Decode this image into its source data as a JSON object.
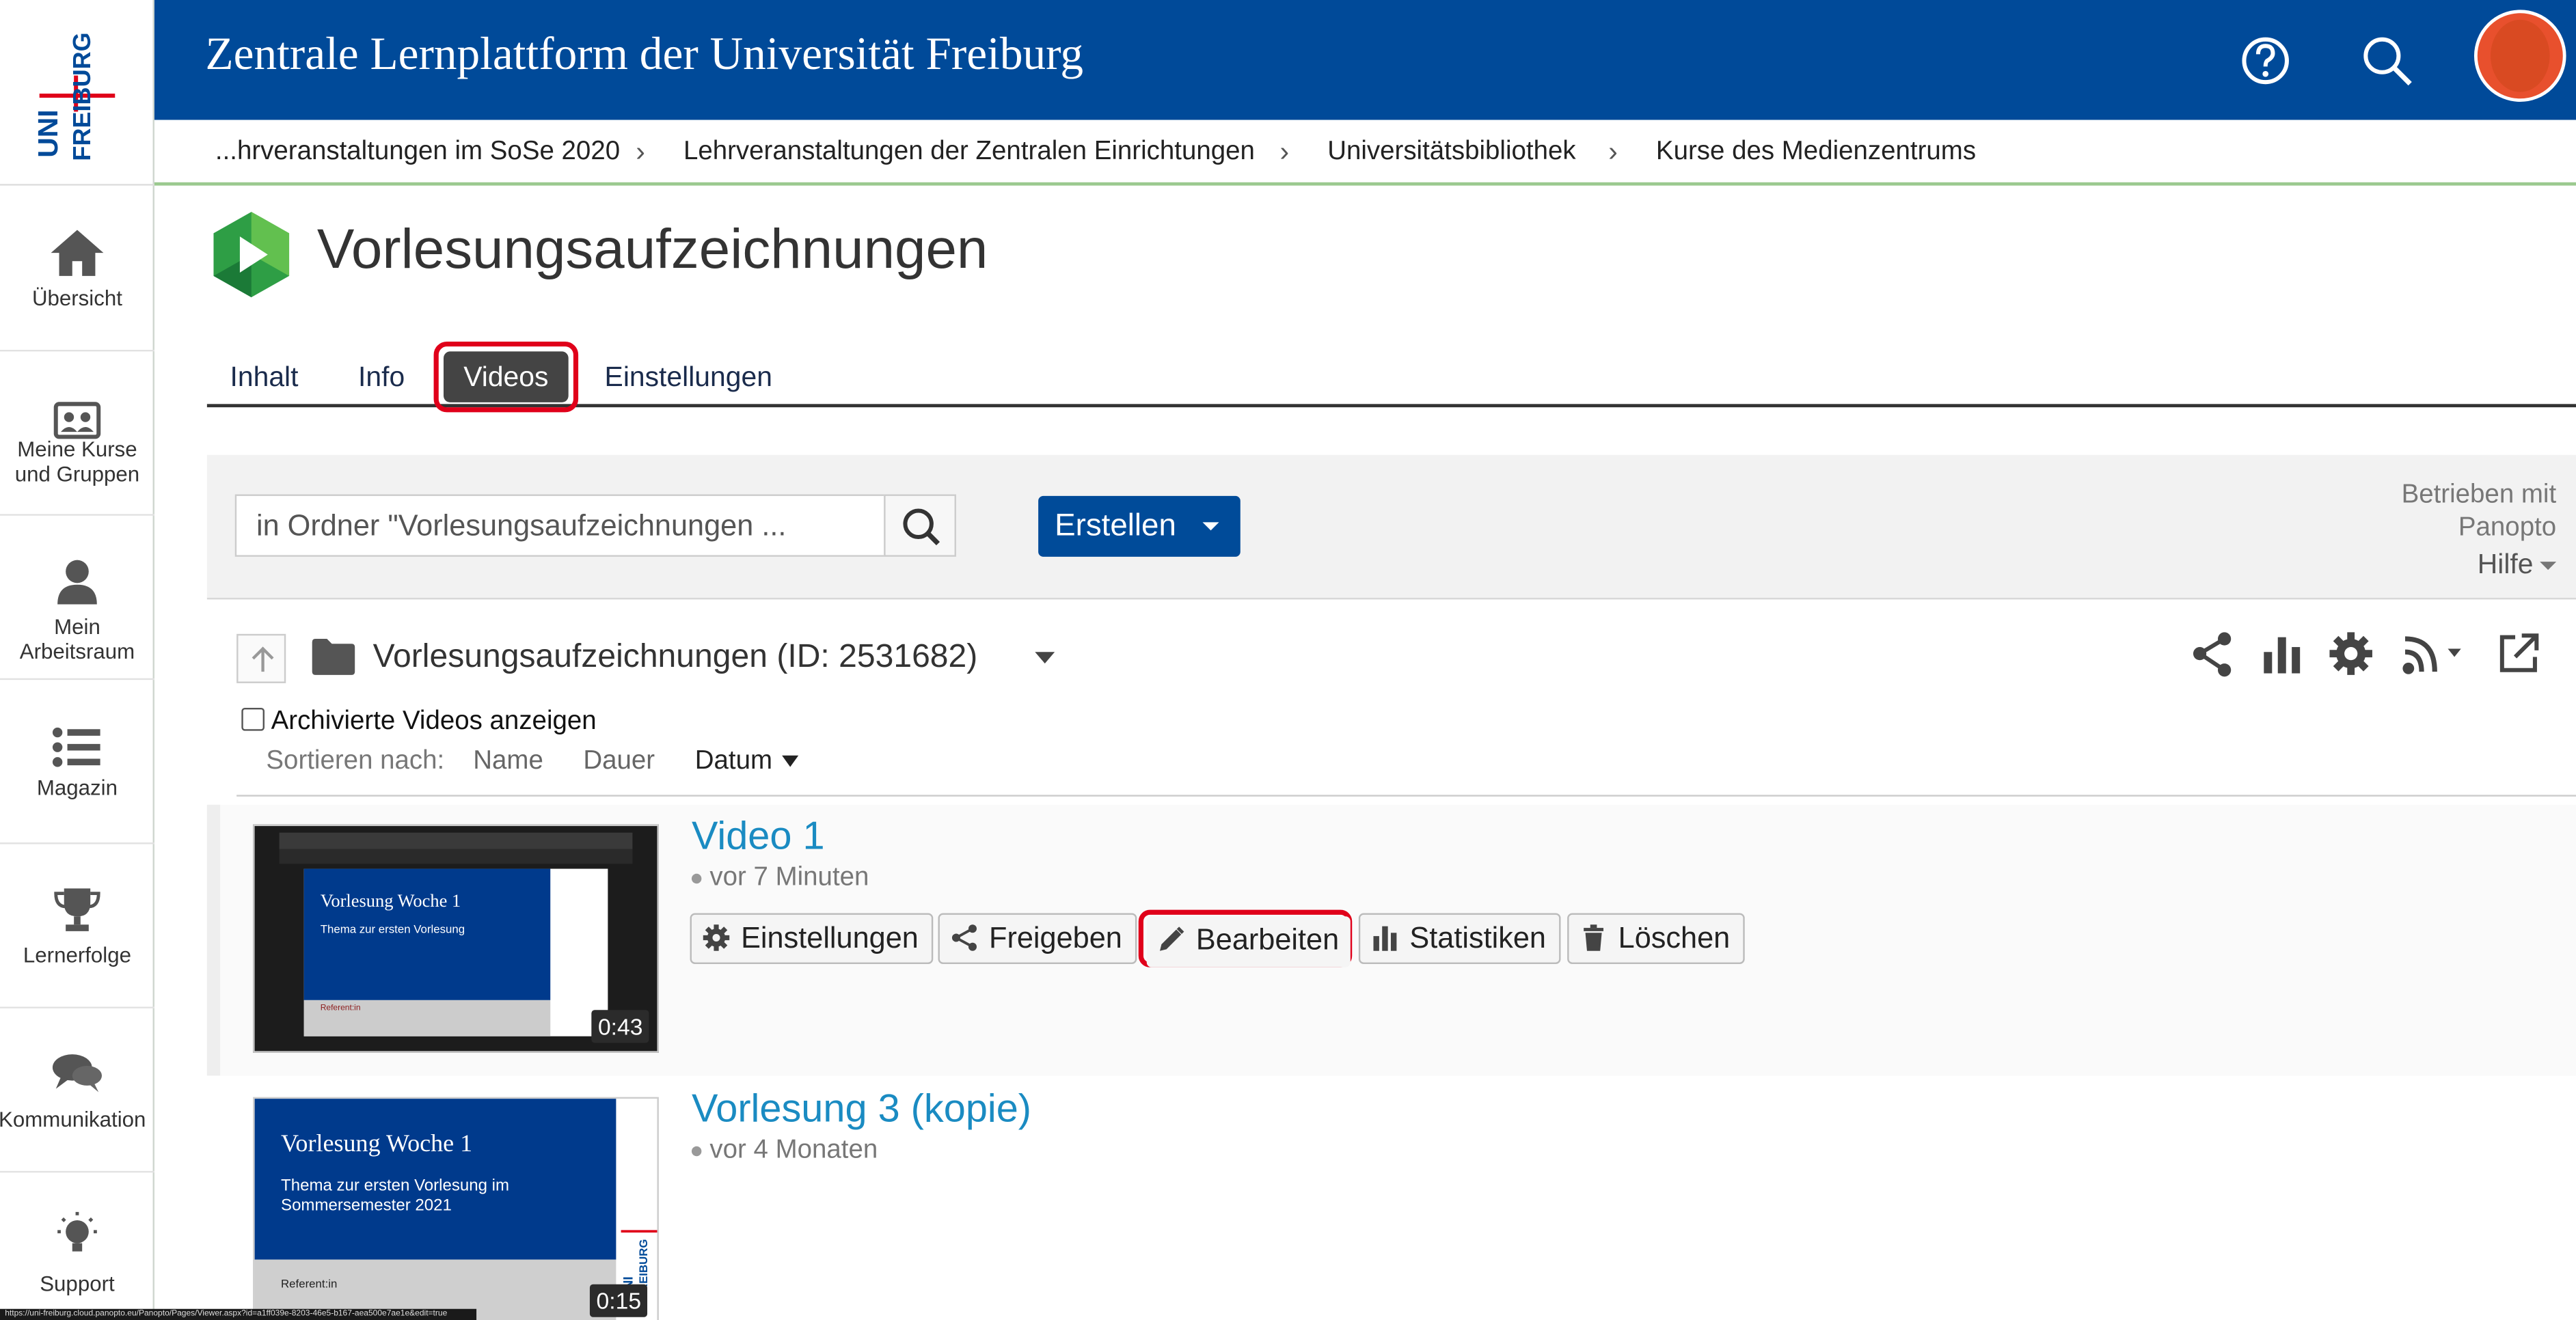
{
  "brand": {
    "logo_text_top": "UNI",
    "logo_text_bottom": "FREIBURG",
    "site_title": "Zentrale Lernplattform der Universität Freiburg",
    "accent": "#004a99",
    "highlight": "#e0001a"
  },
  "sidebar": {
    "items": [
      {
        "label": "Übersicht",
        "icon": "home-icon"
      },
      {
        "label": "Meine Kurse und Gruppen",
        "icon": "courses-icon"
      },
      {
        "label": "Mein Arbeitsraum",
        "icon": "person-icon"
      },
      {
        "label": "Magazin",
        "icon": "list-icon"
      },
      {
        "label": "Lernerfolge",
        "icon": "trophy-icon"
      },
      {
        "label": "Kommunikation",
        "icon": "chat-icon"
      },
      {
        "label": "Support",
        "icon": "lightbulb-icon"
      }
    ]
  },
  "breadcrumb": [
    "...hrveranstaltungen im SoSe 2020",
    "Lehrveranstaltungen der Zentralen Einrichtungen",
    "Universitätsbibliothek",
    "Kurse des Medienzentrums"
  ],
  "page": {
    "title": "Vorlesungsaufzeichnungen"
  },
  "tabs": [
    {
      "label": "Inhalt"
    },
    {
      "label": "Info"
    },
    {
      "label": "Videos",
      "active": true
    },
    {
      "label": "Einstellungen"
    }
  ],
  "toolbar": {
    "search_value": "in Ordner \"Vorlesungsaufzeichnungen ...",
    "create_label": "Erstellen",
    "powered_line1": "Betrieben mit",
    "powered_line2": "Panopto",
    "help_label": "Hilfe"
  },
  "folder": {
    "name": "Vorlesungsaufzeichnungen (ID: 2531682)",
    "archived_label": "Archivierte Videos anzeigen",
    "archived_checked": false,
    "sort_label": "Sortieren nach:",
    "sort_options": [
      "Name",
      "Dauer",
      "Datum"
    ],
    "sort_active": "Datum"
  },
  "videos": [
    {
      "title": "Video 1",
      "age": "vor 7 Minuten",
      "duration": "0:43",
      "thumb_heading": "Vorlesung Woche 1",
      "thumb_sub": "Thema zur ersten Vorlesung",
      "thumb_footer": "Referent:in",
      "actions": [
        "Einstellungen",
        "Freigeben",
        "Bearbeiten",
        "Statistiken",
        "Löschen"
      ]
    },
    {
      "title": "Vorlesung 3 (kopie)",
      "age": "vor 4 Monaten",
      "duration": "0:15",
      "thumb_heading": "Vorlesung Woche 1",
      "thumb_sub": "Thema zur ersten Vorlesung im Sommersemester 2021",
      "thumb_footer": "Referent:in"
    }
  ],
  "status_url": "https://uni-freiburg.cloud.panopto.eu/Panopto/Pages/Viewer.aspx?id=a1ff039e-8203-46e5-b167-aea500e7ae1e&edit=true"
}
